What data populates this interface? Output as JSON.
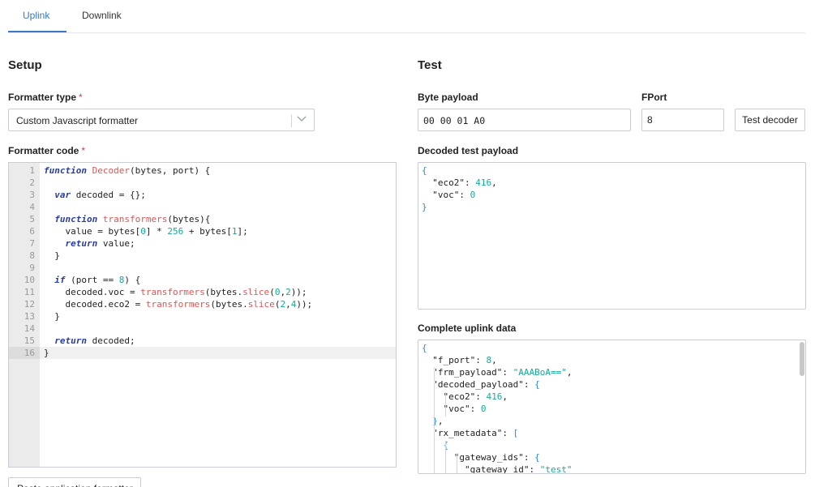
{
  "tabs": [
    {
      "label": "Uplink",
      "active": true
    },
    {
      "label": "Downlink",
      "active": false
    }
  ],
  "setup": {
    "title": "Setup",
    "formatter_type_label": "Formatter type",
    "formatter_type_value": "Custom Javascript formatter",
    "formatter_code_label": "Formatter code",
    "required_mark": "*",
    "code_lines": [
      "function Decoder(bytes, port) {",
      "",
      "  var decoded = {};",
      "",
      "  function transformers(bytes){",
      "    value = bytes[0] * 256 + bytes[1];",
      "    return value;",
      "  }",
      "",
      "  if (port == 8) {",
      "    decoded.voc = transformers(bytes.slice(0,2));",
      "    decoded.eco2 = transformers(bytes.slice(2,4));",
      "  }",
      "",
      "  return decoded;",
      "}"
    ],
    "active_line": 16,
    "bottom_button_label": "Paste application formatter"
  },
  "test": {
    "title": "Test",
    "byte_payload_label": "Byte payload",
    "byte_payload_value": "00 00 01 A0",
    "fport_label": "FPort",
    "fport_value": "8",
    "test_button_label": "Test decoder",
    "decoded_label": "Decoded test payload",
    "decoded_lines": [
      "{",
      "  \"eco2\": 416,",
      "  \"voc\": 0",
      "}"
    ],
    "uplink_label": "Complete uplink data",
    "uplink_lines": [
      "{",
      "  \"f_port\": 8,",
      "  \"frm_payload\": \"AAABoA==\",",
      "  \"decoded_payload\": {",
      "    \"eco2\": 416,",
      "    \"voc\": 0",
      "  },",
      "  \"rx_metadata\": [",
      "    {",
      "      \"gateway_ids\": {",
      "        \"gateway_id\": \"test\""
    ]
  },
  "colors": {
    "accent": "#3a78c9",
    "keyword": "#2a3e99",
    "function_name": "#d75757",
    "number": "#18a89a",
    "required": "#e03b3b"
  }
}
